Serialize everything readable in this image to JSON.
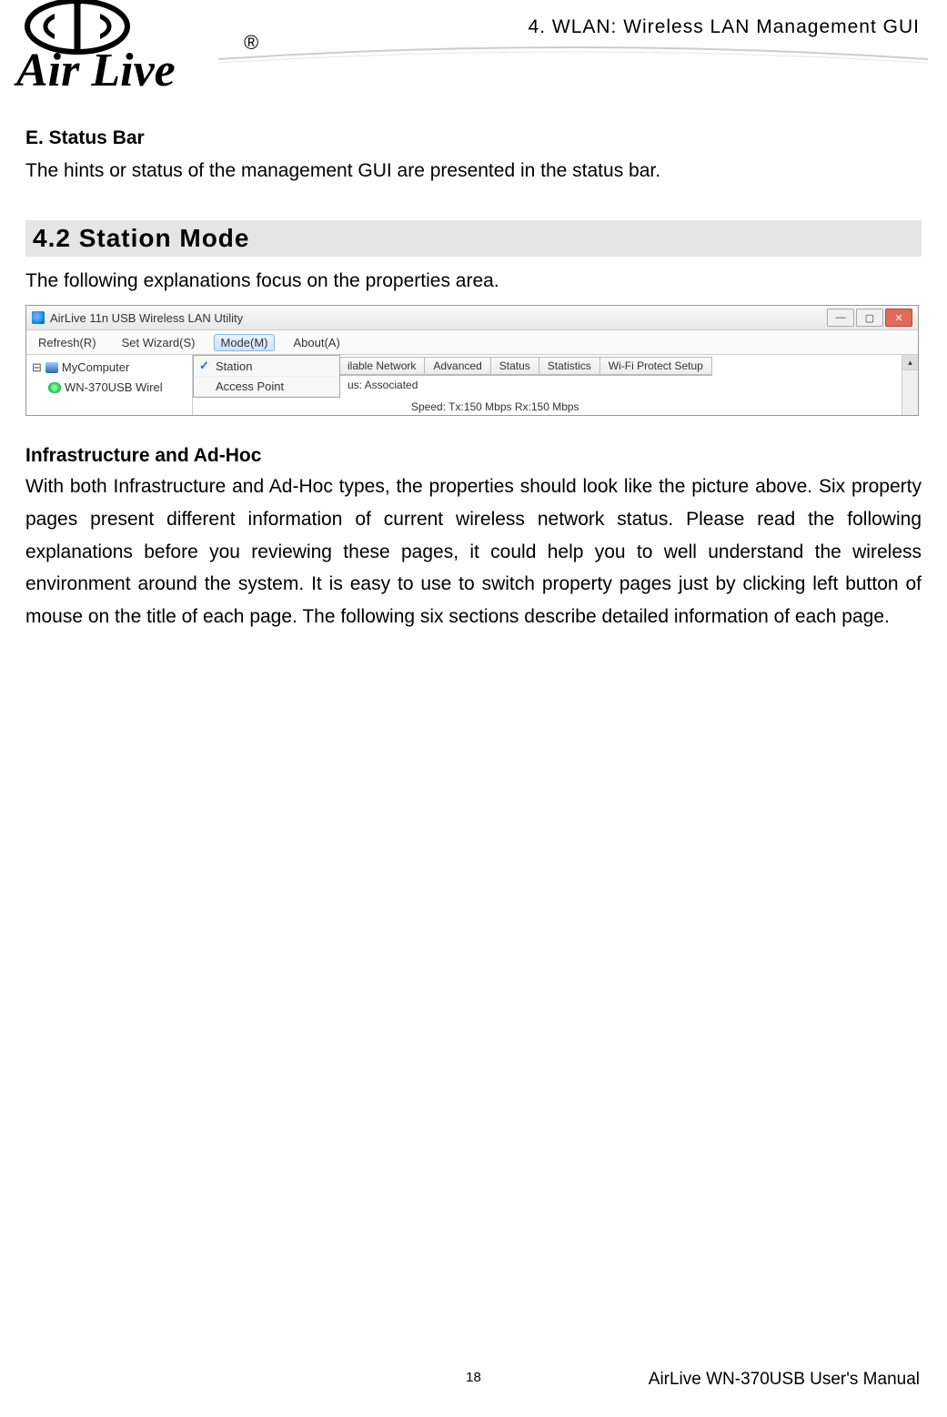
{
  "header": {
    "chapter": "4. WLAN: Wireless LAN Management GUI"
  },
  "logo": {
    "brand": "Air Live",
    "registered": "®"
  },
  "sectionE": {
    "title": "E. Status Bar",
    "body": "The hints or status of the management GUI are presented in the status bar."
  },
  "section42": {
    "heading": "4.2  Station  Mode",
    "intro": "The following explanations focus on the properties area."
  },
  "screenshot": {
    "window_title": "AirLive 11n USB Wireless LAN Utility",
    "menubar": [
      "Refresh(R)",
      "Set Wizard(S)",
      "Mode(M)",
      "About(A)"
    ],
    "active_menu_index": 2,
    "dropdown": {
      "items": [
        {
          "label": "Station",
          "checked": true
        },
        {
          "label": "Access Point",
          "checked": false
        }
      ]
    },
    "tree": {
      "root": "MyComputer",
      "child": "WN-370USB Wirel"
    },
    "tabs": [
      "ilable Network",
      "Advanced",
      "Status",
      "Statistics",
      "Wi-Fi Protect Setup"
    ],
    "status_line": "us:  Associated",
    "speed_line": "Speed:  Tx:150 Mbps Rx:150 Mbps",
    "window_buttons": {
      "min": "—",
      "max": "▢",
      "close": "✕"
    },
    "scroll_up": "▴"
  },
  "infra": {
    "title": "Infrastructure and Ad-Hoc",
    "body": "With both Infrastructure and Ad-Hoc types, the properties should look like the picture above. Six property pages present different information of current wireless network status. Please read the following explanations before you reviewing these pages, it could help you to well understand the wireless environment around the system. It is easy to use to switch property pages just by clicking left button of mouse on the title of each page. The following six sections describe detailed information of each page."
  },
  "footer": {
    "page_number": "18",
    "manual": "AirLive WN-370USB User's Manual"
  }
}
